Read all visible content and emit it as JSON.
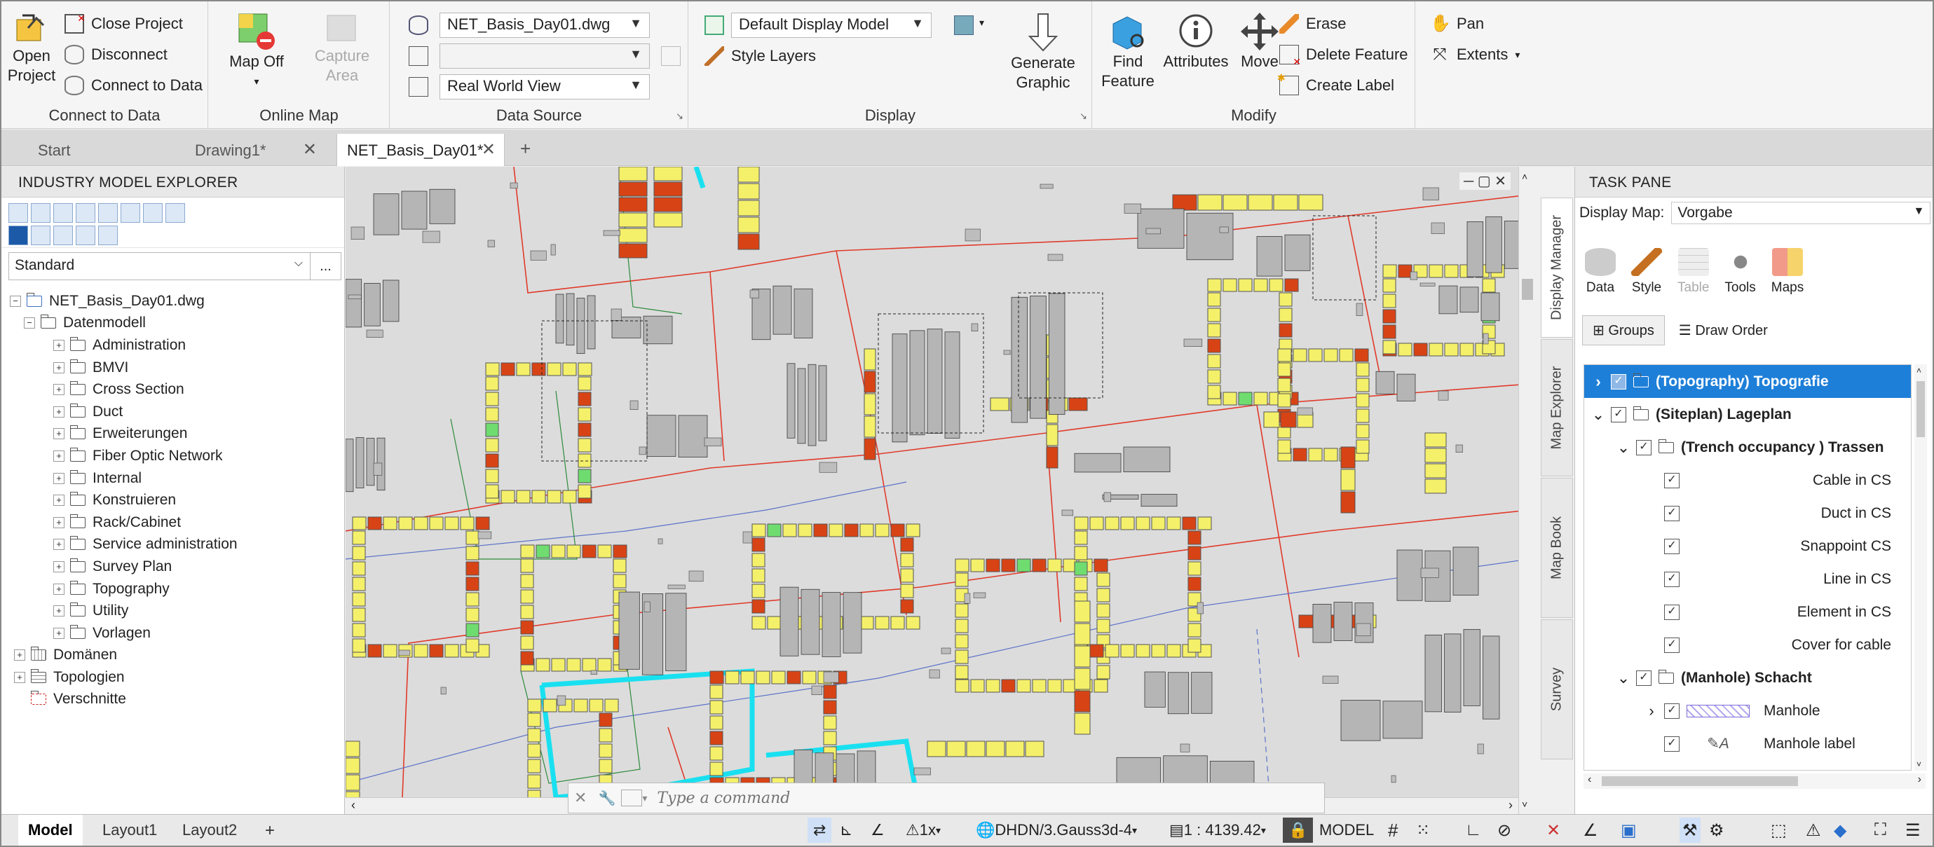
{
  "ribbon": {
    "connect": {
      "open_project": "Open\nProject",
      "close_project": "Close Project",
      "disconnect": "Disconnect",
      "connect_to_data": "Connect to Data",
      "title": "Connect to Data"
    },
    "online_map": {
      "map_off": "Map Off",
      "capture_area": "Capture\nArea",
      "title": "Online Map"
    },
    "data_source": {
      "drawing": "NET_Basis_Day01.dwg",
      "view": "Real World View",
      "title": "Data Source"
    },
    "display": {
      "display_model": "Default Display Model",
      "style_layers": "Style Layers",
      "generate_graphic": "Generate\nGraphic",
      "title": "Display"
    },
    "modify": {
      "find_feature": "Find\nFeature",
      "attributes": "Attributes",
      "move": "Move",
      "erase": "Erase",
      "delete_feature": "Delete Feature",
      "create_label": "Create Label",
      "title": "Modify"
    },
    "nav": {
      "pan": "Pan",
      "extents": "Extents"
    }
  },
  "doc_tabs": {
    "start": "Start",
    "drawing1": "Drawing1*",
    "net": "NET_Basis_Day01*",
    "add": "+"
  },
  "explorer": {
    "title": "INDUSTRY MODEL EXPLORER",
    "combo": "Standard",
    "combo_btn": "...",
    "root": "NET_Basis_Day01.dwg",
    "datenmodell": "Datenmodell",
    "items": [
      "Administration",
      "BMVI",
      "Cross Section",
      "Duct",
      "Erweiterungen",
      "Fiber Optic Network",
      "Internal",
      "Konstruieren",
      "Rack/Cabinet",
      "Service administration",
      "Survey Plan",
      "Topography",
      "Utility",
      "Vorlagen"
    ],
    "domaenen": "Domänen",
    "topologien": "Topologien",
    "verschnitte": "Verschnitte"
  },
  "command": {
    "placeholder": "Type a command"
  },
  "task_pane": {
    "title": "TASK PANE",
    "display_map_label": "Display Map:",
    "display_map_value": "Vorgabe",
    "tools": {
      "data": "Data",
      "style": "Style",
      "table": "Table",
      "tools": "Tools",
      "maps": "Maps"
    },
    "groups": "Groups",
    "draw_order": "Draw Order",
    "vertical_tabs": {
      "display_manager": "Display Manager",
      "map_explorer": "Map Explorer",
      "map_book": "Map Book",
      "survey": "Survey"
    },
    "layers": [
      {
        "label": "(Topography) Topografie"
      },
      {
        "label": "(Siteplan) Lageplan"
      },
      {
        "label": "(Trench occupancy ) Trassen"
      },
      {
        "label": "Cable in CS"
      },
      {
        "label": "Duct in CS"
      },
      {
        "label": "Snappoint CS"
      },
      {
        "label": "Line in CS"
      },
      {
        "label": "Element in CS"
      },
      {
        "label": "Cover for cable"
      },
      {
        "label": "(Manhole) Schacht"
      },
      {
        "label": "Manhole"
      },
      {
        "label": "Manhole label"
      }
    ]
  },
  "status": {
    "model": "Model",
    "layout1": "Layout1",
    "layout2": "Layout2",
    "add": "+",
    "scale_annot": "1x",
    "coord_system": "DHDN/3.Gauss3d-4",
    "scale": "1 : 4139.42",
    "space": "MODEL"
  },
  "colors": {
    "accent": "#1e7fd8",
    "building": "#ff0",
    "building_red": "#d84315",
    "building_green": "#6fdc6f",
    "cyan": "#19e0f0",
    "parcel": "#e03a2a"
  }
}
